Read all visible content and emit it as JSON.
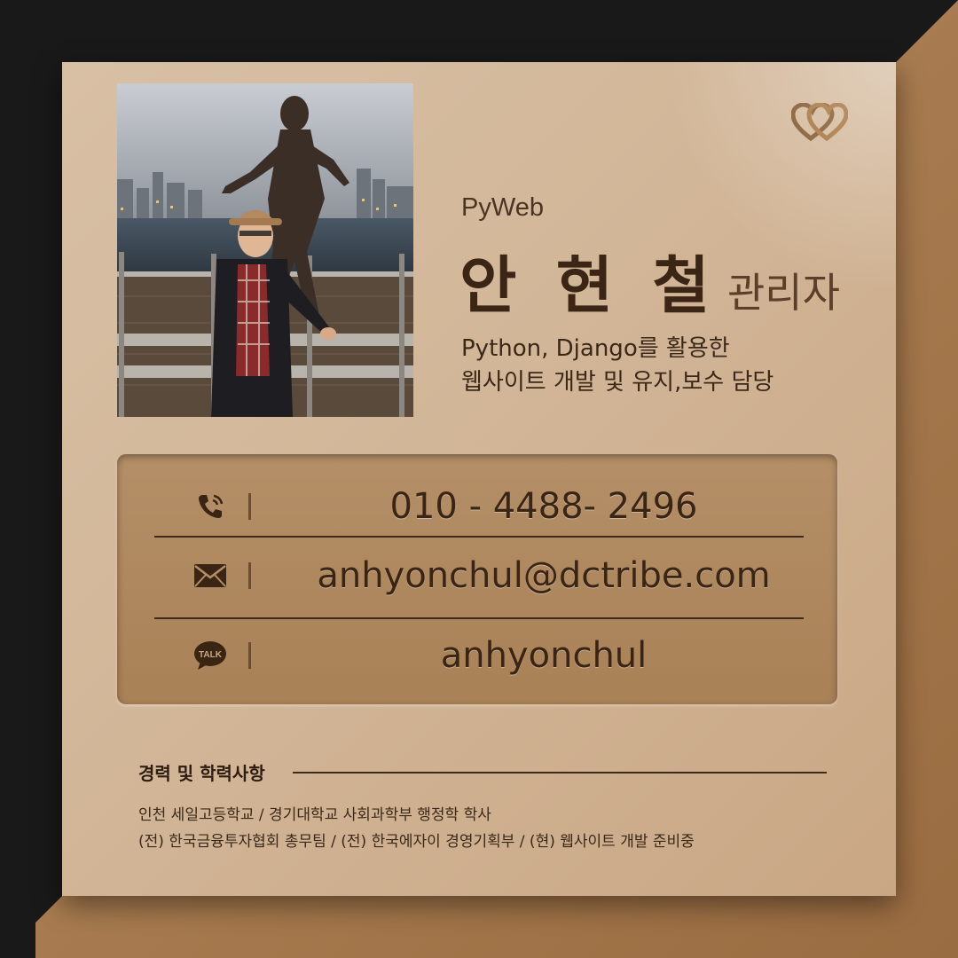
{
  "brand": "PyWeb",
  "name": "안 현 철",
  "role": "관리자",
  "description": [
    "Python, Django를 활용한",
    "웹사이트 개발 및 유지,보수 담당"
  ],
  "contacts": {
    "phone": {
      "icon": "phone-icon",
      "value": "010 - 4488- 2496"
    },
    "email": {
      "icon": "mail-icon",
      "value": "anhyonchul@dctribe.com"
    },
    "talk": {
      "icon": "talk-icon",
      "label": "TALK",
      "value": "anhyonchul"
    }
  },
  "career": {
    "title": "경력 및 학력사항",
    "lines": [
      "인천 세일고등학교 / 경기대학교 사회과학부 행정학 학사",
      "(전) 한국금융투자협회 총무팀 / (전) 한국에자이 경영기획부 / (현) 웹사이트 개발 준비중"
    ]
  },
  "colors": {
    "card": "#d2b698",
    "panel": "#ad8660",
    "text_dark": "#3b2515",
    "accent": "#6e4c30"
  }
}
